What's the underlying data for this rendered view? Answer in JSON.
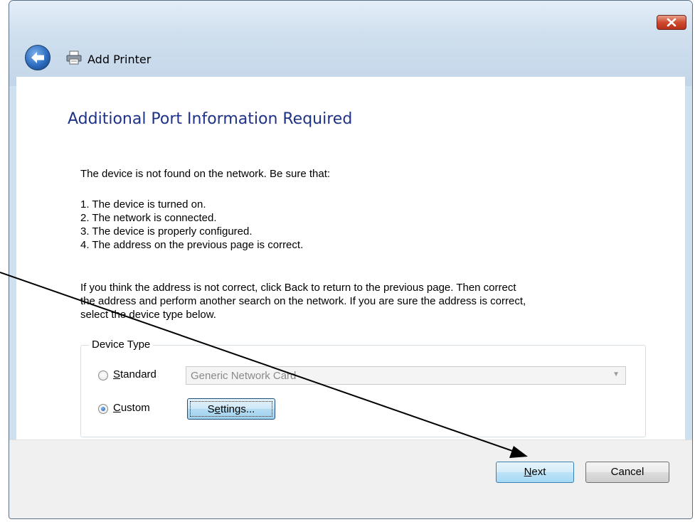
{
  "window": {
    "title": "Add Printer",
    "close_label": "x"
  },
  "page": {
    "heading": "Additional Port Information Required",
    "intro": "The device is not found on the network.  Be sure that:",
    "checklist": [
      "1.  The device is turned on.",
      "2.  The network is connected.",
      "3.  The device is properly configured.",
      "4.  The address on the previous page is correct."
    ],
    "note_lines": [
      "If you think the address is not correct, click Back to return to the previous page.  Then correct",
      "the address and perform another search on the network.  If you are sure the address is correct,",
      "select the device type below."
    ]
  },
  "device_type": {
    "label": "Device Type",
    "standard": {
      "mnemonic": "S",
      "rest": "tandard",
      "selected": false,
      "combo_value": "Generic Network Card"
    },
    "custom": {
      "mnemonic": "C",
      "rest": "ustom",
      "selected": true
    },
    "settings_button": {
      "pre": "S",
      "mnemonic": "e",
      "post": "ttings..."
    }
  },
  "footer": {
    "next": {
      "mnemonic": "N",
      "rest": "ext"
    },
    "cancel": "Cancel"
  },
  "colors": {
    "heading": "#1e3287",
    "frame": "#cfe0ef",
    "footer": "#f0f0f0",
    "close_button": "#cf4a2f"
  }
}
